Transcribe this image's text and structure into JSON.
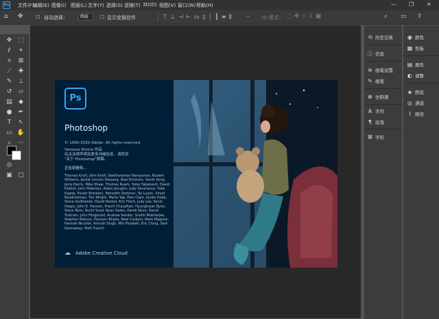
{
  "menubar": {
    "app_icon": "Ps",
    "items": [
      "文件(F)",
      "编辑(E)",
      "图像(I)",
      "图层(L)",
      "文字(Y)",
      "选择(S)",
      "滤镜(T)",
      "3D(D)",
      "视图(V)",
      "窗口(W)",
      "帮助(H)"
    ],
    "window_controls": [
      "—",
      "❐",
      "✕"
    ]
  },
  "options": {
    "auto_select_label": "自动选择：",
    "auto_select_value": "图层",
    "show_transform_label": "显示变换控件",
    "mode_3d": "3D 模式：",
    "more": "···"
  },
  "splash": {
    "logo": "Ps",
    "app_name": "Photoshop",
    "copyright": "© 1990-2020 Adobe. All rights reserved.",
    "artist": "Vanessa Rivera 作品",
    "legal_line1": "有关法律声明及更多详细信息，请转到",
    "legal_line2": "\"关于 Photoshop\"屏幕。",
    "status": "正在初始化...",
    "credits": "Thomas Knoll, John Knoll, Seetharaman Narayanan, Russell Williams, Jackie Lincoln-Owyang, Alan Erickson, Sarah Kong, Jerry Harris, Mike Shaw, Thomas Ruark, Yukie Takahashi, David Dobish, John Peterson, Adam Jerugim, Judy Severance, Yuko Kagita, Foster Brereton, Meredith Stotzner, Tai Luxon, Vinod Balakrishnan, Tim Wright, Maria Yap, Pam Clark, Kyoko Itoda, Steve Guilhamet, David Hackel, Eric Floch, Judy Lee, Kevin Hopps, John E. Hanson, Prachi Chaudhari, Hyunghwan Byun, Steve Ross, Ruchi Sood, Ryan Gates, Derek Novo, David Tristram, John Fitzgerald, Andrew Sender, Srishti Mukherjee, Stephen Nielson, Poonam Bhalla, Noel Carboni, Mark Maguire, Hannah Nicollet, Aniruth Singh, Min Plunkett, Eric Ching, Sam Gannaway, Matt Fuerch",
    "brand": "Adobe Creative Cloud"
  },
  "panels_col1": [
    {
      "icon": "history-icon",
      "glyph": "⟲",
      "label": "历史记录"
    },
    {
      "icon": "info-icon",
      "glyph": "ⓘ",
      "label": "信息"
    },
    {
      "icon": "brush-settings-icon",
      "glyph": "≋",
      "label": "画笔设置"
    },
    {
      "icon": "brush-icon",
      "glyph": "✎",
      "label": "画笔"
    },
    {
      "icon": "clone-source-icon",
      "glyph": "⊕",
      "label": "仿制源"
    },
    {
      "icon": "character-icon",
      "glyph": "A",
      "label": "字符"
    },
    {
      "icon": "paragraph-icon",
      "glyph": "¶",
      "label": "段落"
    },
    {
      "icon": "glyphs-icon",
      "glyph": "⌘",
      "label": "字形"
    }
  ],
  "panels_col2": [
    {
      "icon": "color-icon",
      "glyph": "◉",
      "label": "颜色"
    },
    {
      "icon": "swatches-icon",
      "glyph": "▦",
      "label": "色板"
    },
    {
      "icon": "properties-icon",
      "glyph": "▤",
      "label": "属性"
    },
    {
      "icon": "adjustments-icon",
      "glyph": "◐",
      "label": "调整"
    },
    {
      "icon": "layers-icon",
      "glyph": "◈",
      "label": "图层"
    },
    {
      "icon": "channels-icon",
      "glyph": "◎",
      "label": "通道"
    },
    {
      "icon": "paths-icon",
      "glyph": "⌇",
      "label": "路径"
    }
  ],
  "colors": {
    "accent": "#31a8ff",
    "splash_bg": "#001e36"
  }
}
